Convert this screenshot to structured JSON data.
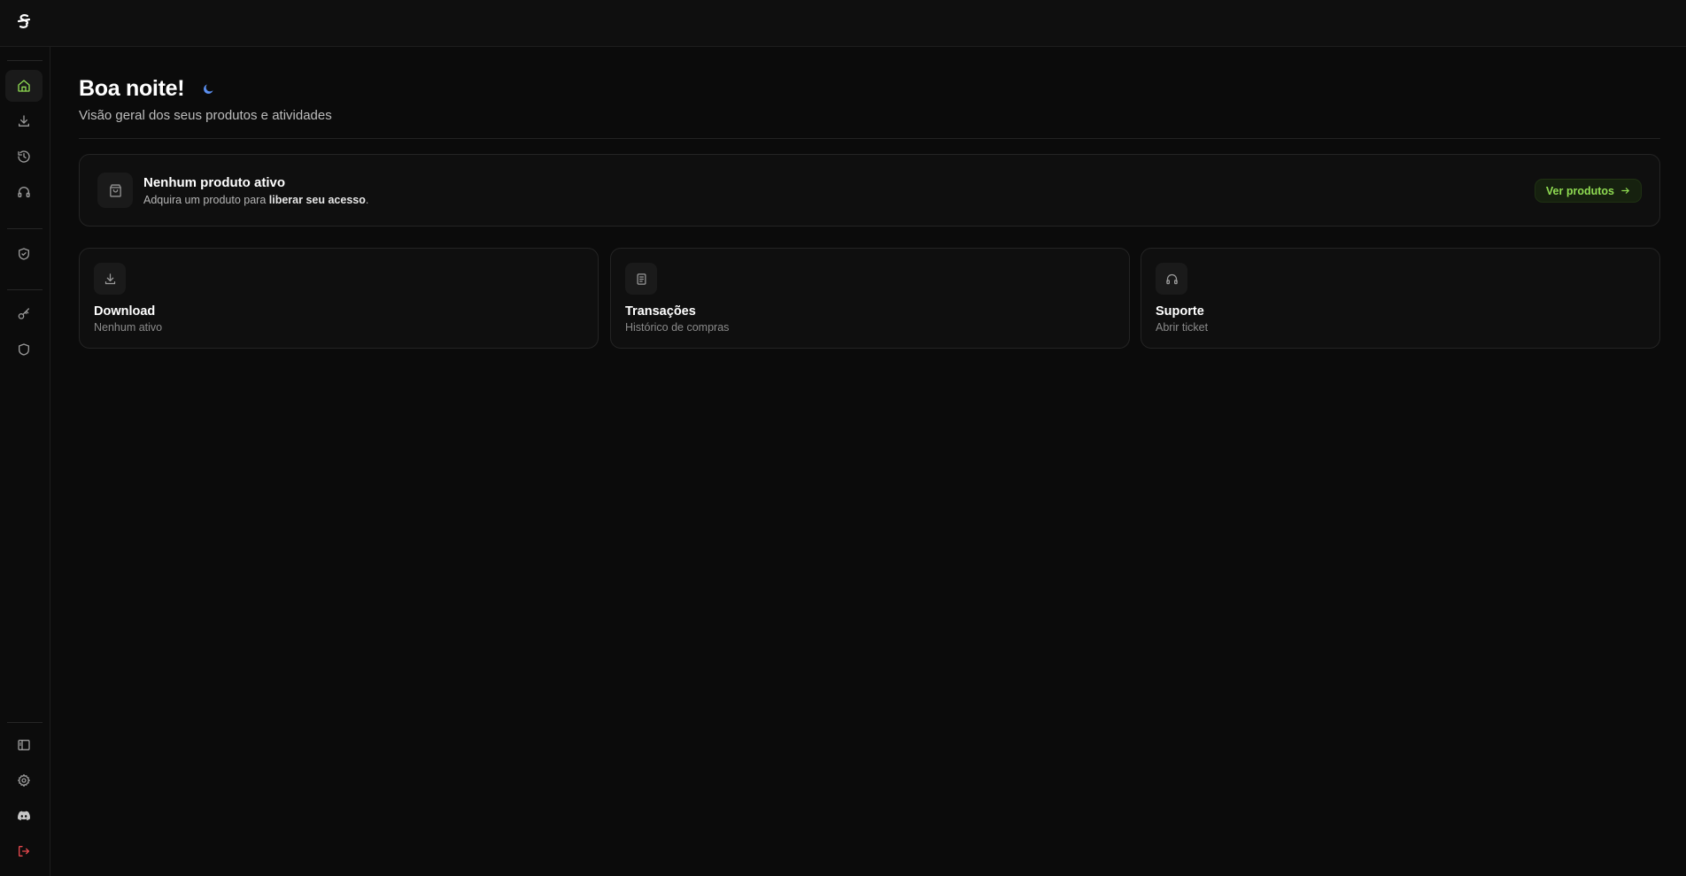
{
  "colors": {
    "background": "#0b0b0b",
    "accent_green": "#8fdb52",
    "moon_blue": "#5b8ff0",
    "logout_red": "#e5484d",
    "muted_text": "#8a8a8a"
  },
  "header": {
    "logo_icon": "brand-logo-icon"
  },
  "sidebar": {
    "items": [
      {
        "icon": "home-icon",
        "active": true
      },
      {
        "icon": "download-icon"
      },
      {
        "icon": "history-icon"
      },
      {
        "icon": "headphones-icon"
      },
      {
        "icon": "shield-check-icon"
      },
      {
        "icon": "key-icon"
      },
      {
        "icon": "shield-icon"
      }
    ],
    "bottom_items": [
      {
        "icon": "sidebar-toggle-icon"
      },
      {
        "icon": "gear-icon"
      },
      {
        "icon": "discord-icon"
      },
      {
        "icon": "logout-icon"
      }
    ]
  },
  "main": {
    "greeting": "Boa noite!",
    "greeting_icon": "moon-icon",
    "subtitle": "Visão geral dos seus produtos e atividades",
    "banner": {
      "icon": "shopping-bag-icon",
      "title": "Nenhum produto ativo",
      "desc_prefix": "Adquira um produto para ",
      "desc_bold": "liberar seu acesso",
      "desc_suffix": ".",
      "button_label": "Ver produtos",
      "button_icon": "arrow-right-icon"
    },
    "cards": [
      {
        "icon": "download-icon",
        "title": "Download",
        "subtitle": "Nenhum ativo"
      },
      {
        "icon": "document-icon",
        "title": "Transações",
        "subtitle": "Histórico de compras"
      },
      {
        "icon": "headphones-icon",
        "title": "Suporte",
        "subtitle": "Abrir ticket"
      }
    ]
  }
}
